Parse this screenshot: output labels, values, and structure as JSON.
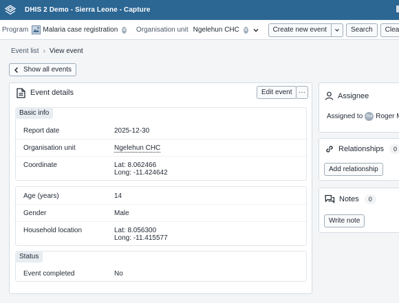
{
  "app": {
    "title": "DHIS 2 Demo - Sierra Leone - Capture"
  },
  "toolbar": {
    "program_label": "Program",
    "program_value": "Malaria case registration",
    "orgunit_label": "Organisation unit",
    "orgunit_value": "Ngelehun CHC",
    "create_label": "Create new event",
    "search_label": "Search",
    "clear_label": "Clear s"
  },
  "breadcrumb": {
    "parent": "Event list",
    "separator": "›",
    "current": "View event"
  },
  "back_button": {
    "label": "Show all events"
  },
  "event_details": {
    "title": "Event details",
    "edit_label": "Edit event",
    "more_label": "···",
    "basic_info": {
      "header": "Basic info",
      "report_date_label": "Report date",
      "report_date_value": "2025-12-30",
      "org_unit_label": "Organisation unit",
      "org_unit_value": "Ngelehun CHC",
      "coordinate_label": "Coordinate",
      "coordinate_lat": "Lat: 8.062466",
      "coordinate_long": "Long: -11.424642"
    },
    "data": {
      "age_label": "Age (years)",
      "age_value": "14",
      "gender_label": "Gender",
      "gender_value": "Male",
      "household_label": "Household location",
      "household_lat": "Lat: 8.056300",
      "household_long": "Long: -11.415577"
    },
    "status": {
      "header": "Status",
      "completed_label": "Event completed",
      "completed_value": "No"
    }
  },
  "assignee": {
    "title": "Assignee",
    "assigned_to_label": "Assigned to",
    "avatar_initials": "RM",
    "assigned_name": "Roger M"
  },
  "relationships": {
    "title": "Relationships",
    "count": "0",
    "add_label": "Add relationship"
  },
  "notes": {
    "title": "Notes",
    "count": "0",
    "write_label": "Write note"
  },
  "colors": {
    "header_bg": "#2c6693",
    "page_bg": "#f3f5f7",
    "section_header_bg": "#e8edf2"
  }
}
